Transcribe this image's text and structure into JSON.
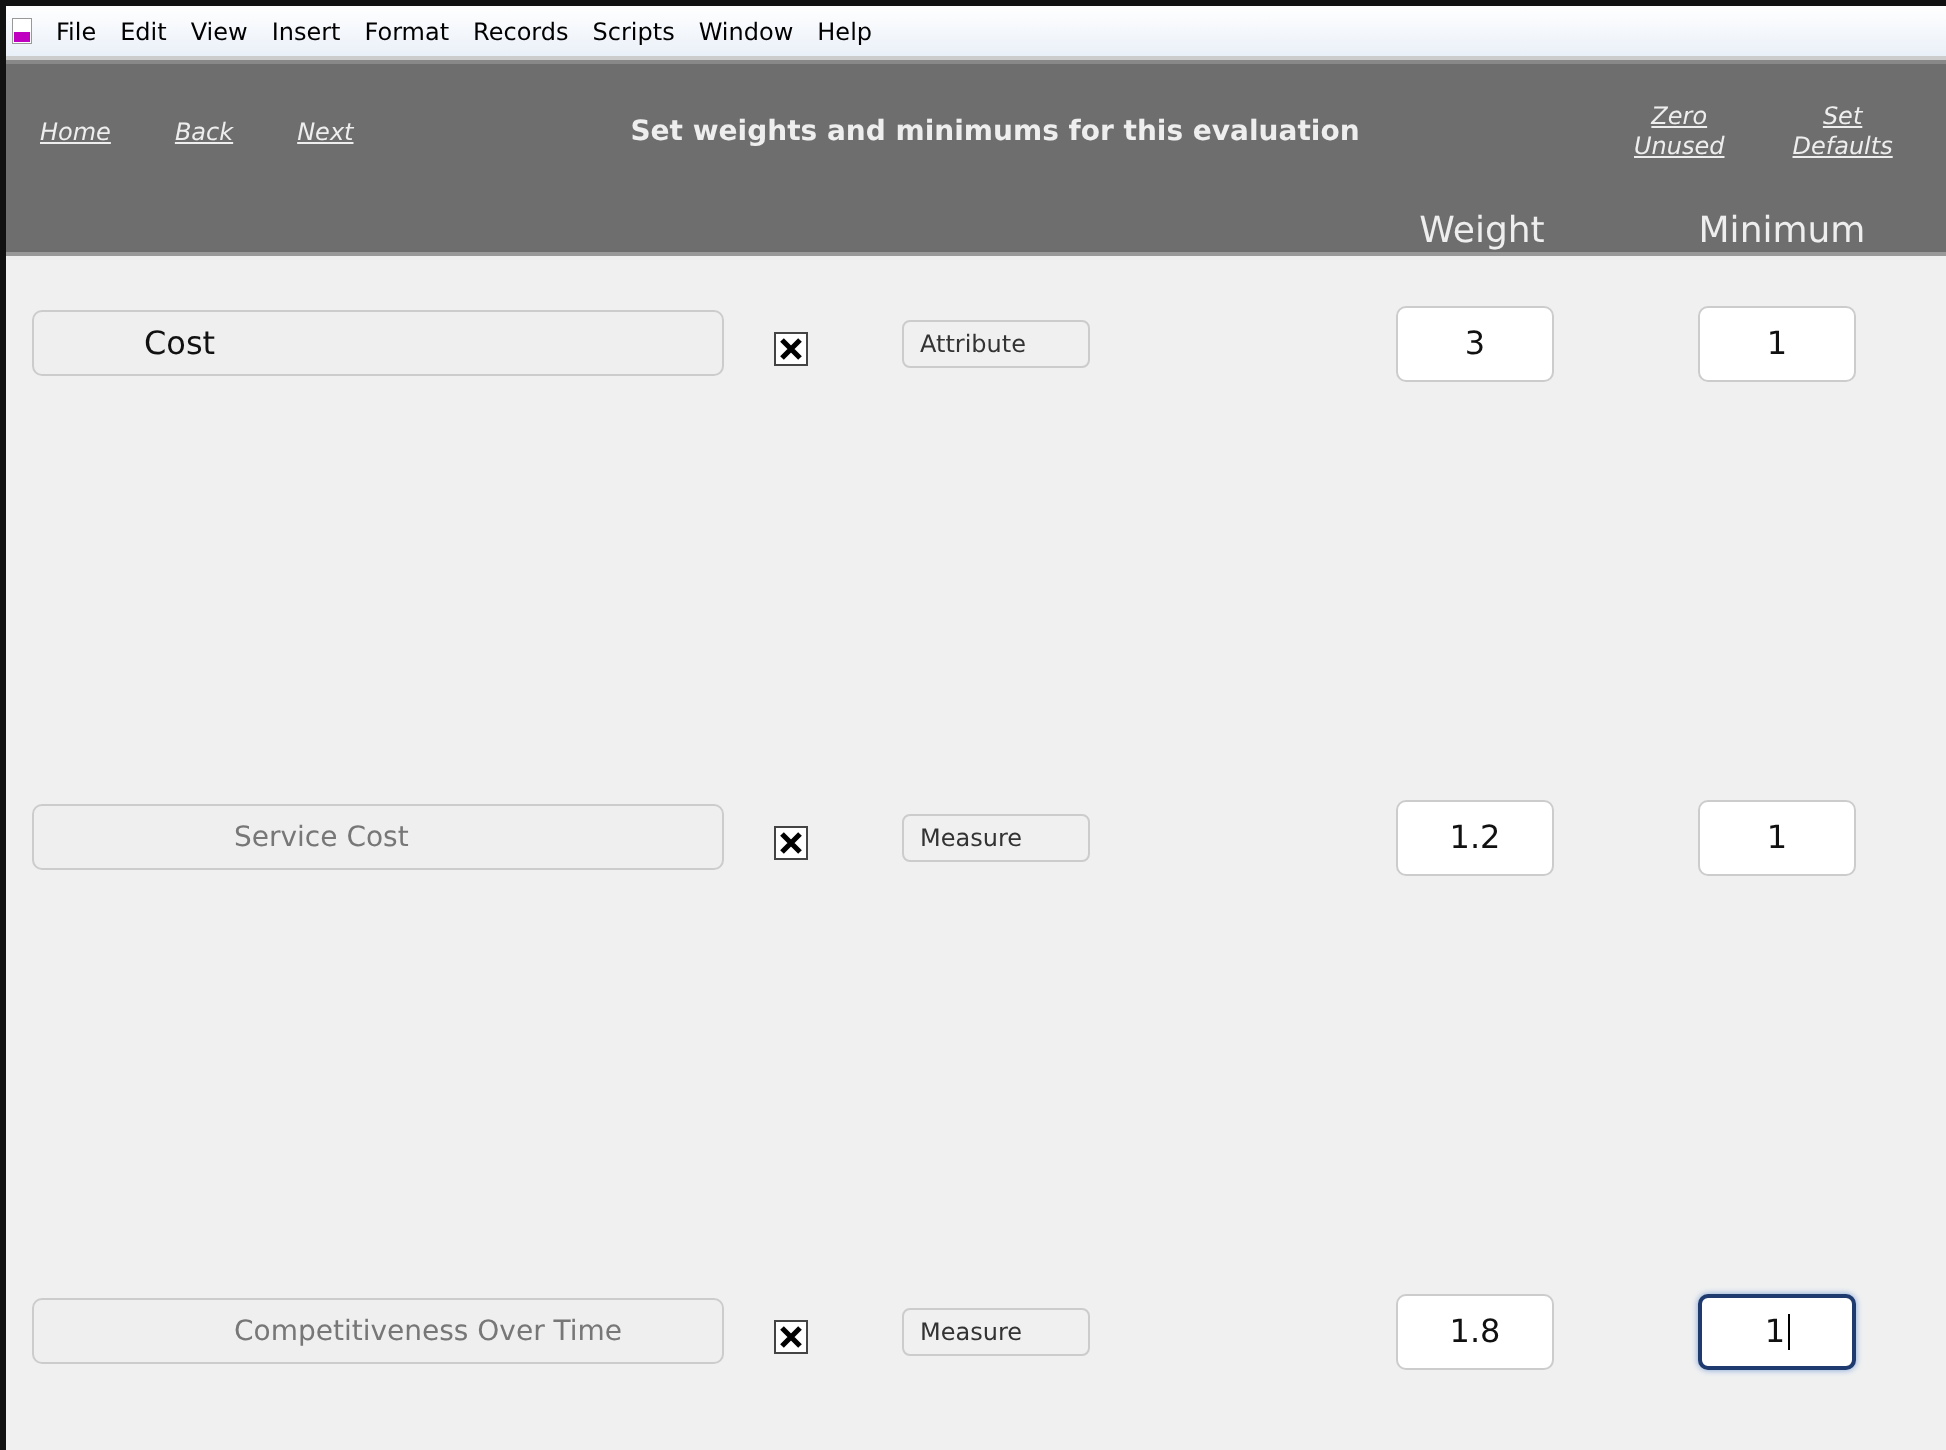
{
  "menu": [
    "File",
    "Edit",
    "View",
    "Insert",
    "Format",
    "Records",
    "Scripts",
    "Window",
    "Help"
  ],
  "nav": [
    "Home",
    "Back",
    "Next"
  ],
  "title": "Set weights and minimums for this evaluation",
  "actions": [
    {
      "line1": "Zero",
      "line2": "Unused"
    },
    {
      "line1": "Set",
      "line2": "Defaults"
    }
  ],
  "columns": [
    "Weight",
    "Minimum"
  ],
  "rows": [
    {
      "name": "Cost",
      "kind": "attribute",
      "checked": true,
      "type": "Attribute",
      "weight": "3",
      "minimum": "1",
      "focused": false
    },
    {
      "name": "Service Cost",
      "kind": "measure",
      "checked": true,
      "type": "Measure",
      "weight": "1.2",
      "minimum": "1",
      "focused": false
    },
    {
      "name": "Competitiveness Over Time",
      "kind": "measure",
      "checked": true,
      "type": "Measure",
      "weight": "1.8",
      "minimum": "1",
      "focused": true
    }
  ]
}
